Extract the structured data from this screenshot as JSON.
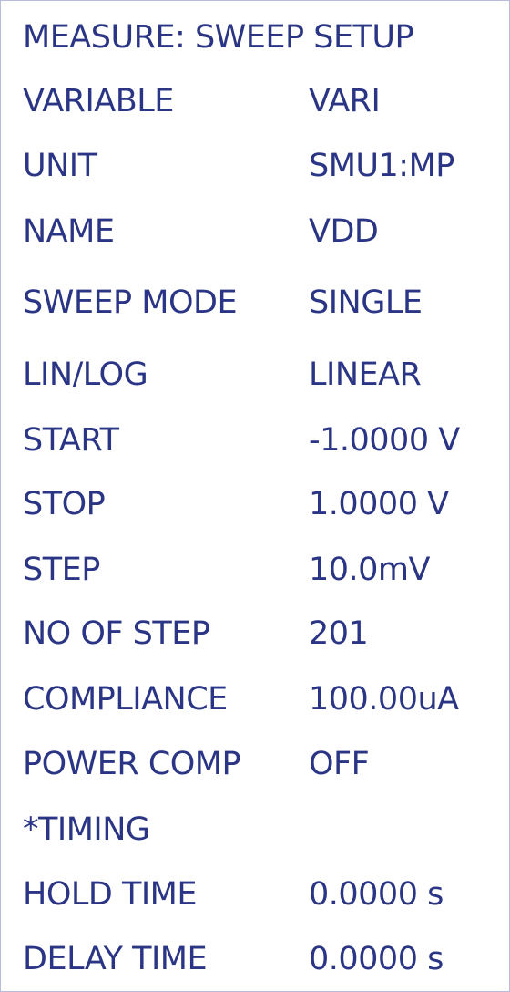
{
  "title": "MEASURE: SWEEP SETUP",
  "rows": [
    {
      "label": "VARIABLE",
      "value": "VARI"
    },
    {
      "label": "UNIT",
      "value": "SMU1:MP"
    },
    {
      "label": "NAME",
      "value": "VDD"
    },
    {
      "label": "SWEEP MODE",
      "value": "SINGLE"
    },
    {
      "label": "LIN/LOG",
      "value": "LINEAR"
    },
    {
      "label": "START",
      "value": "-1.0000 V"
    },
    {
      "label": "STOP",
      "value": "1.0000 V"
    },
    {
      "label": "STEP",
      "value": "10.0mV"
    },
    {
      "label": "NO OF STEP",
      "value": "201"
    },
    {
      "label": "COMPLIANCE",
      "value": "100.00uA"
    },
    {
      "label": "POWER COMP",
      "value": "OFF"
    },
    {
      "label": "*TIMING",
      "value": ""
    },
    {
      "label": "HOLD TIME",
      "value": "0.0000 s"
    },
    {
      "label": "DELAY TIME",
      "value": "0.0000 s"
    }
  ],
  "colors": {
    "text": "#2b3585",
    "border": "#b9bcd8",
    "background": "#ffffff"
  }
}
